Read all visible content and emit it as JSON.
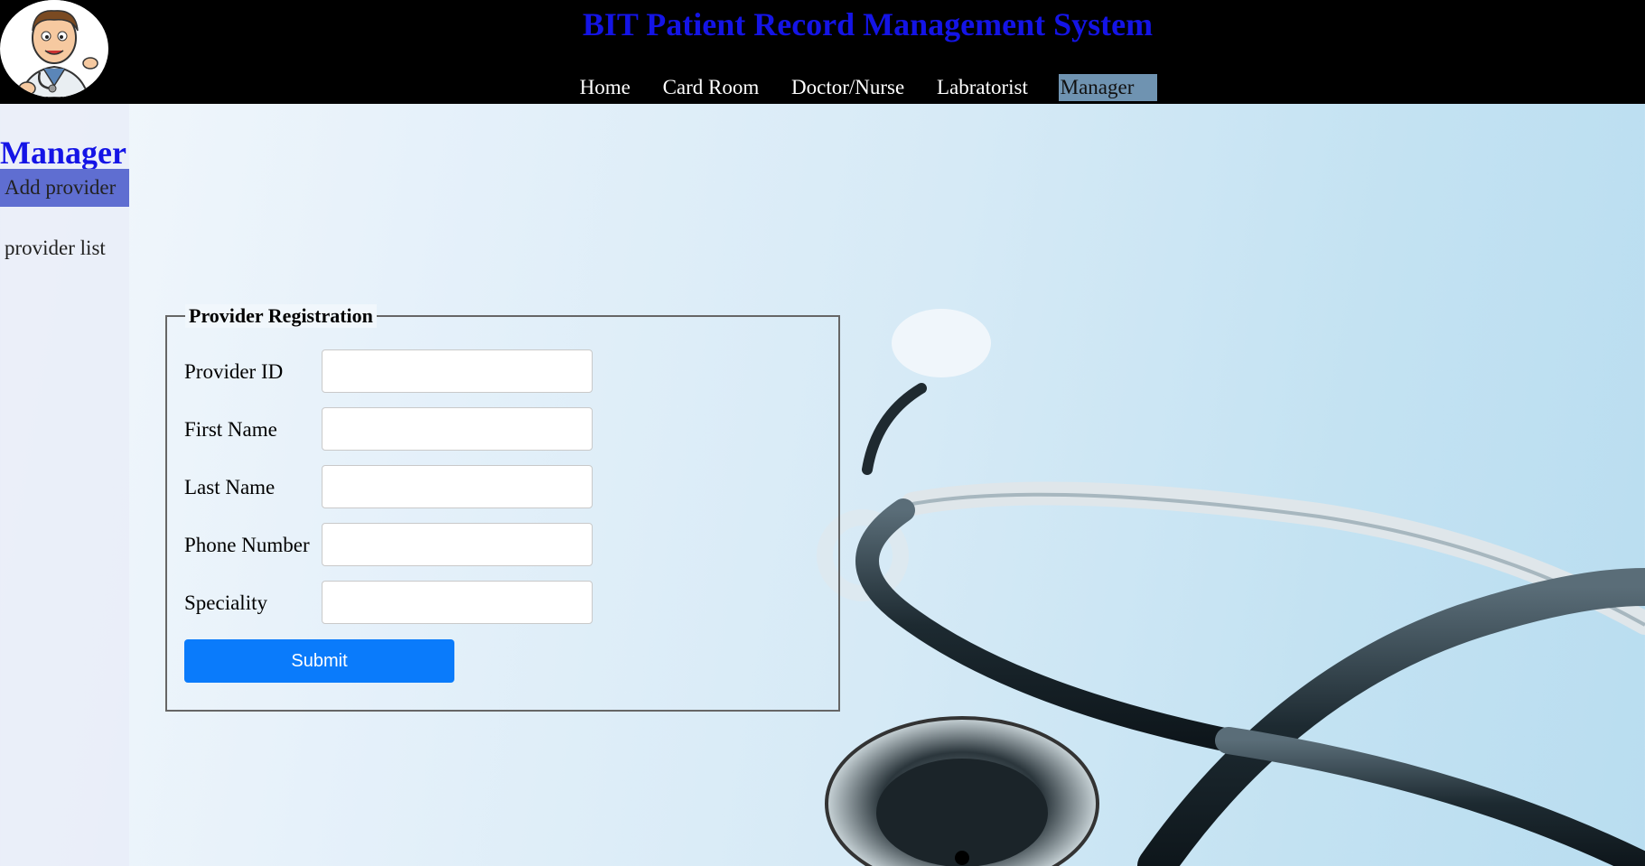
{
  "header": {
    "title": "BIT Patient Record Management System",
    "nav": [
      "Home",
      "Card Room",
      "Doctor/Nurse",
      "Labratorist",
      "Manager"
    ],
    "active_nav": "Manager"
  },
  "sidebar": {
    "title": "Manager",
    "items": [
      "Add provider",
      "provider list"
    ]
  },
  "form": {
    "legend": "Provider Registration",
    "fields": [
      {
        "label": "Provider ID",
        "value": ""
      },
      {
        "label": "First Name",
        "value": ""
      },
      {
        "label": "Last Name",
        "value": ""
      },
      {
        "label": "Phone Number",
        "value": ""
      },
      {
        "label": "Speciality",
        "value": ""
      }
    ],
    "submit_label": "Submit"
  },
  "colors": {
    "title": "#1414e6",
    "header_bg": "#000000",
    "active_nav_bg": "#6f93b1",
    "sidebar_active_bg": "#5f6ed1",
    "submit_bg": "#0a7bfb"
  },
  "icons": {
    "logo": "doctor-cartoon-logo"
  }
}
